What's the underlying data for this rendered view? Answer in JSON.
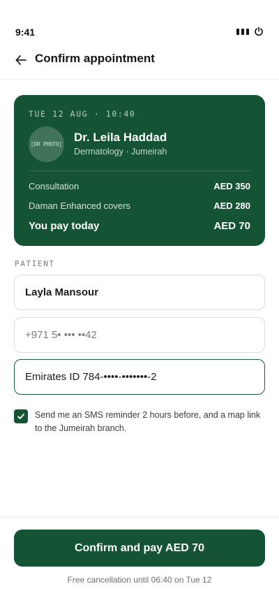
{
  "status_bar": {
    "time": "9:41",
    "icons": [
      "signal-icon",
      "power-icon"
    ]
  },
  "header": {
    "back_icon": "arrow-left-icon",
    "title": "Confirm appointment"
  },
  "appointment": {
    "datetime": "TUE 12 AUG · 10:40",
    "doctor_photo_placeholder": "[DR PHOTO]",
    "doctor_name": "Dr. Leila Haddad",
    "specialty": "Dermatology · Jumeirah",
    "pricing": [
      {
        "label": "Consultation",
        "value": "AED 350"
      },
      {
        "label": "Daman Enhanced covers",
        "value": "AED 280"
      },
      {
        "label": "You pay today",
        "value": "AED 70"
      }
    ]
  },
  "patient": {
    "section_label": "PATIENT",
    "name_value": "Layla Mansour",
    "phone_placeholder": "+971 5• ••• ••42",
    "emirates_id_value": "Emirates ID 784-••••-•••••••-2"
  },
  "sms_reminder": {
    "checked": true,
    "text": "Send me an SMS reminder 2 hours before, and a map link to the Jumeirah branch."
  },
  "footer": {
    "confirm_label": "Confirm and pay AED 70",
    "cancellation_note": "Free cancellation until 06:40 on Tue 12"
  },
  "colors": {
    "brand": "#145333",
    "card_text_muted": "#c4d8cb",
    "field_border": "#dcdcdc",
    "field_focus_border": "#1e5b3a"
  }
}
